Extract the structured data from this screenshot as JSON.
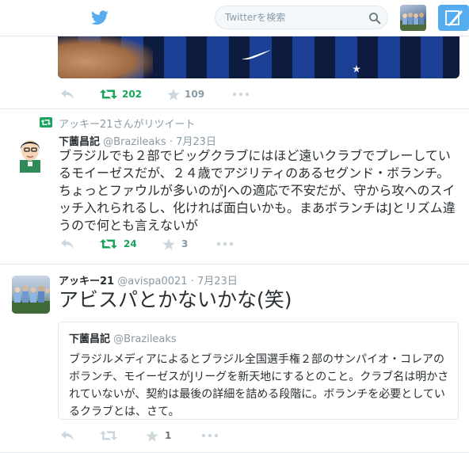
{
  "nav": {
    "search_placeholder": "Twitterを検索"
  },
  "tweet_top": {
    "retweet_count": "202",
    "favorite_count": "109"
  },
  "tweet_mid": {
    "retweeted_by": "アッキー21さんがリツイート",
    "display_name": "下薗昌記",
    "handle": "@Brazileaks",
    "date": "7月23日",
    "text": "ブラジルでも２部でビッグクラブにはほど遠いクラブでプレーしているモイーゼスだが、２４歳でアジリティのあるセグンド・ボランチ。ちょっとファウルが多いのがJへの適応で不安だが、守から攻へのスイッチ入れられるし、化ければ面白いかも。まあボランチはJとリズム違うので何とも言えないが",
    "retweet_count": "24",
    "favorite_count": "3"
  },
  "tweet_bottom": {
    "display_name": "アッキー21",
    "handle": "@avispa0021",
    "date": "7月23日",
    "text": "アビスパとかないかな(笑)",
    "favorite_count": "1",
    "quote": {
      "display_name": "下薗昌記",
      "handle": "@Brazileaks",
      "text": "ブラジルメディアによるとブラジル全国選手権２部のサンパイオ・コレアのボランチ、モイーゼスがJリーグを新天地にするとのこと。クラブ名は明かされていないが、契約は最後の詳細を詰める段階に。ボランチを必要としているクラブとは、さて。"
    }
  },
  "colors": {
    "twitter_blue": "#55acee",
    "retweet_green": "#19a45b",
    "muted_gray": "#8899a6",
    "text_dark": "#292f33",
    "border": "#e1e8ed"
  }
}
